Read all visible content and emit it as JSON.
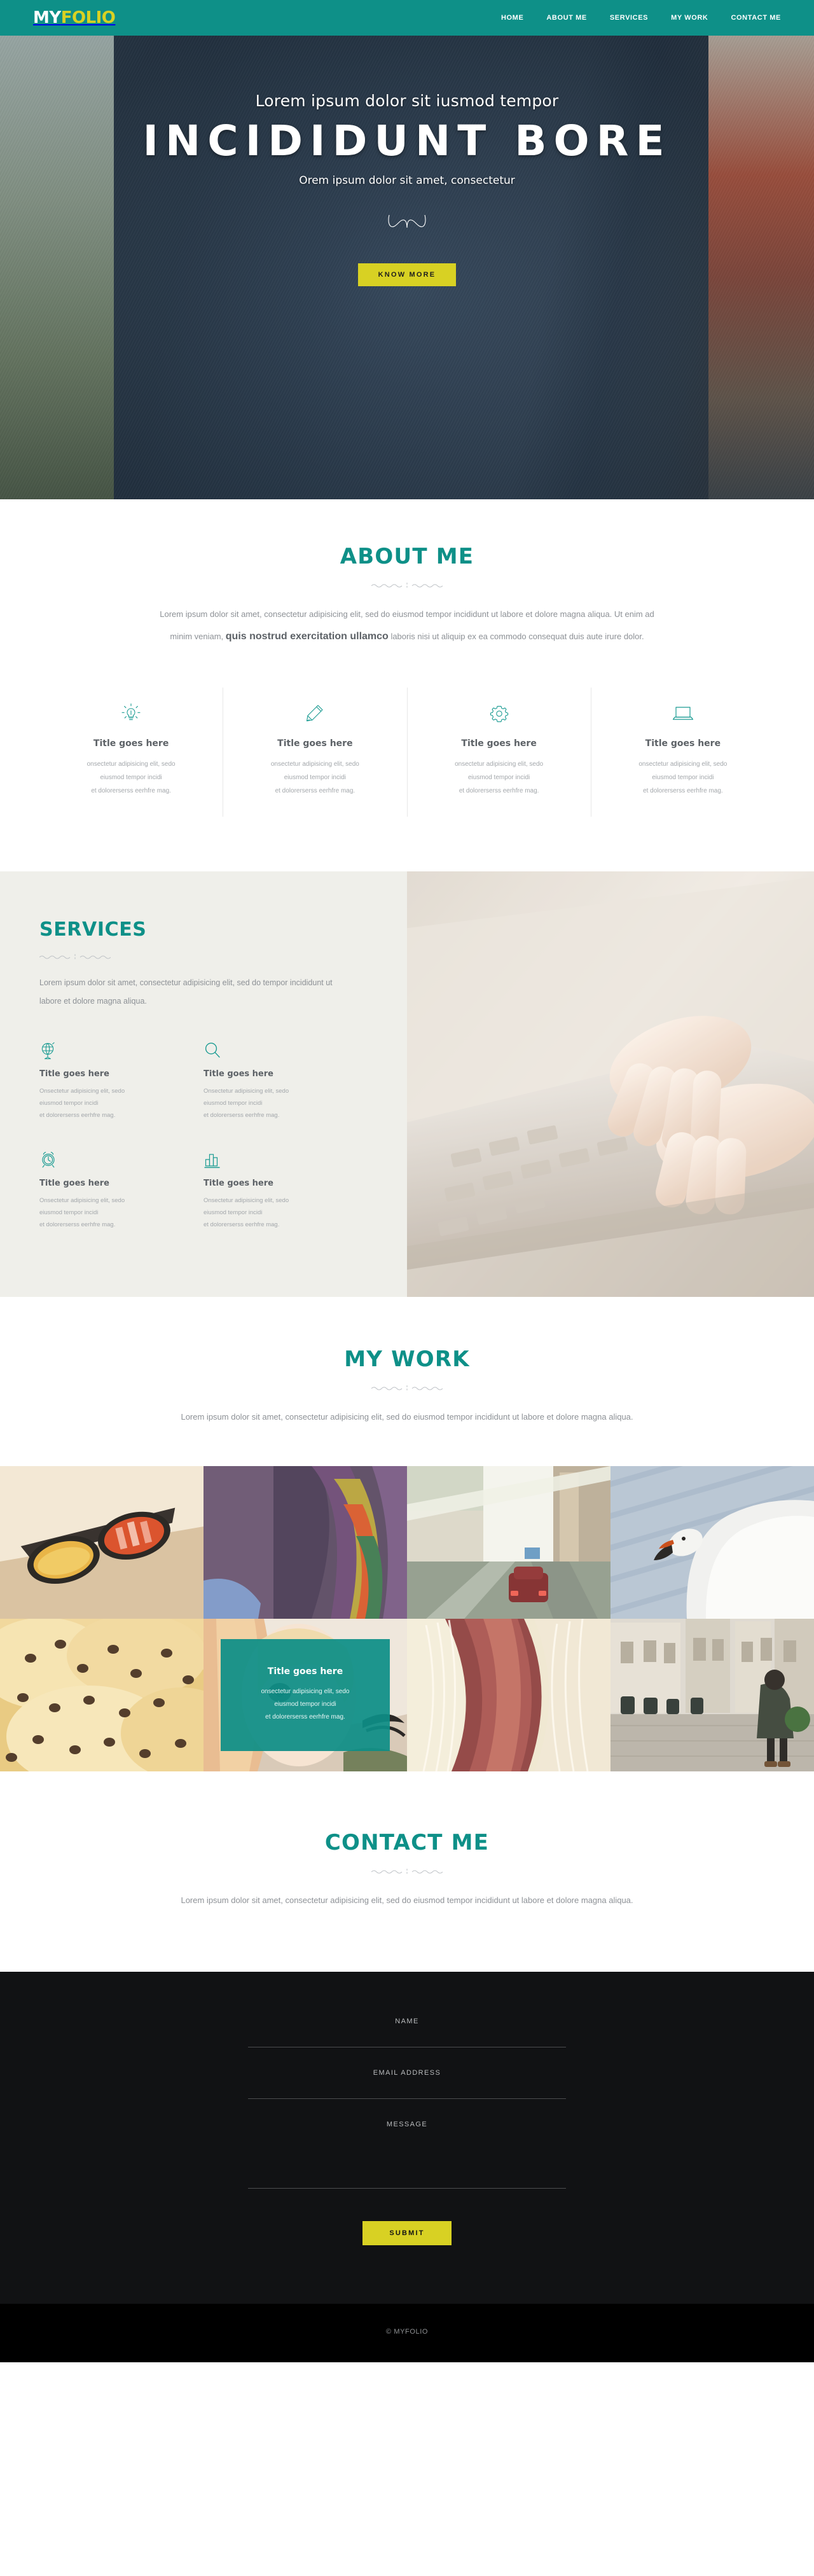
{
  "header": {
    "logo_my": "MY",
    "logo_folio": "FOLIO",
    "nav": [
      {
        "label": "HOME"
      },
      {
        "label": "ABOUT ME"
      },
      {
        "label": "SERVICES"
      },
      {
        "label": "MY WORK"
      },
      {
        "label": "CONTACT ME"
      }
    ]
  },
  "hero": {
    "subtitle_top": "Lorem ipsum dolor sit iusmod tempor",
    "title": "INCIDIDUNT BORE",
    "subtitle_bottom": "Orem ipsum dolor sit amet, consectetur",
    "cta_label": "KNOW MORE"
  },
  "about": {
    "title": "ABOUT ME",
    "paragraph_a": "Lorem ipsum dolor sit amet, consectetur adipisicing elit, sed do eiusmod tempor incididunt ut labore et dolore magna aliqua. Ut enim ad minim veniam, ",
    "paragraph_strong": "quis nostrud exercitation ullamco",
    "paragraph_b": " laboris nisi ut aliquip ex ea commodo consequat duis aute irure dolor.",
    "features": [
      {
        "icon": "lightbulb-icon",
        "title": "Title goes here",
        "line1": "onsectetur adipisicing elit, sedo",
        "line2": "eiusmod tempor incidi",
        "line3": "et dolorerserss eerhfre mag."
      },
      {
        "icon": "pencil-icon",
        "title": "Title goes here",
        "line1": "onsectetur adipisicing elit, sedo",
        "line2": "eiusmod tempor incidi",
        "line3": "et dolorerserss eerhfre mag."
      },
      {
        "icon": "gear-icon",
        "title": "Title goes here",
        "line1": "onsectetur adipisicing elit, sedo",
        "line2": "eiusmod tempor incidi",
        "line3": "et dolorerserss eerhfre mag."
      },
      {
        "icon": "laptop-icon",
        "title": "Title goes here",
        "line1": "onsectetur adipisicing elit, sedo",
        "line2": "eiusmod tempor incidi",
        "line3": "et dolorerserss eerhfre mag."
      }
    ]
  },
  "services": {
    "title": "SERVICES",
    "paragraph": "Lorem ipsum dolor sit amet, consectetur adipisicing elit, sed do tempor incididunt ut labore et dolore magna aliqua.",
    "items": [
      {
        "icon": "globe-icon",
        "title": "Title goes here",
        "line1": "Onsectetur adipisicing elit, sedo",
        "line2": "eiusmod tempor incidi",
        "line3": "et dolorerserss eerhfre mag."
      },
      {
        "icon": "magnifier-icon",
        "title": "Title goes here",
        "line1": "Onsectetur adipisicing elit, sedo",
        "line2": "eiusmod tempor incidi",
        "line3": "et dolorerserss eerhfre mag."
      },
      {
        "icon": "alarm-clock-icon",
        "title": "Title goes here",
        "line1": "Onsectetur adipisicing elit, sedo",
        "line2": "eiusmod tempor incidi",
        "line3": "et dolorerserss eerhfre mag."
      },
      {
        "icon": "bar-chart-icon",
        "title": "Title goes here",
        "line1": "Onsectetur adipisicing elit, sedo",
        "line2": "eiusmod tempor incidi",
        "line3": "et dolorerserss eerhfre mag."
      }
    ],
    "photo_alt": "hands-typing-on-laptop-photo"
  },
  "work": {
    "title": "MY WORK",
    "paragraph": "Lorem ipsum dolor sit amet, consectetur adipisicing elit, sed do eiusmod tempor incididunt ut labore et dolore magna aliqua.",
    "tiles": [
      {
        "alt": "sunglasses-photo",
        "overlay": false
      },
      {
        "alt": "colorful-feathers-photo",
        "overlay": false
      },
      {
        "alt": "car-in-tunnel-photo",
        "overlay": false
      },
      {
        "alt": "swan-photo",
        "overlay": false
      },
      {
        "alt": "pastry-photo",
        "overlay": false
      },
      {
        "alt": "portrait-photo",
        "overlay": true,
        "title": "Title goes here",
        "line1": "onsectetur adipisicing elit, sedo",
        "line2": "eiusmod tempor incidi",
        "line3": "et dolorerserss eerhfre mag."
      },
      {
        "alt": "horse-mane-photo",
        "overlay": false
      },
      {
        "alt": "woman-walking-street-photo",
        "overlay": false
      }
    ]
  },
  "contact": {
    "title": "CONTACT ME",
    "paragraph": "Lorem ipsum dolor sit amet, consectetur adipisicing elit, sed do eiusmod tempor incididunt ut labore et dolore magna aliqua.",
    "fields": {
      "name_label": "NAME",
      "name_value": "",
      "email_label": "EMAIL ADDRESS",
      "email_value": "",
      "message_label": "MESSAGE",
      "message_value": ""
    },
    "submit_label": "SUBMIT"
  },
  "footer": {
    "copyright": "© MYFOLIO"
  },
  "colors": {
    "teal": "#0E9088",
    "yellow": "#D8D123",
    "services_bg": "#EFEFEA",
    "dark_form": "#111214",
    "footer_black": "#000000"
  }
}
